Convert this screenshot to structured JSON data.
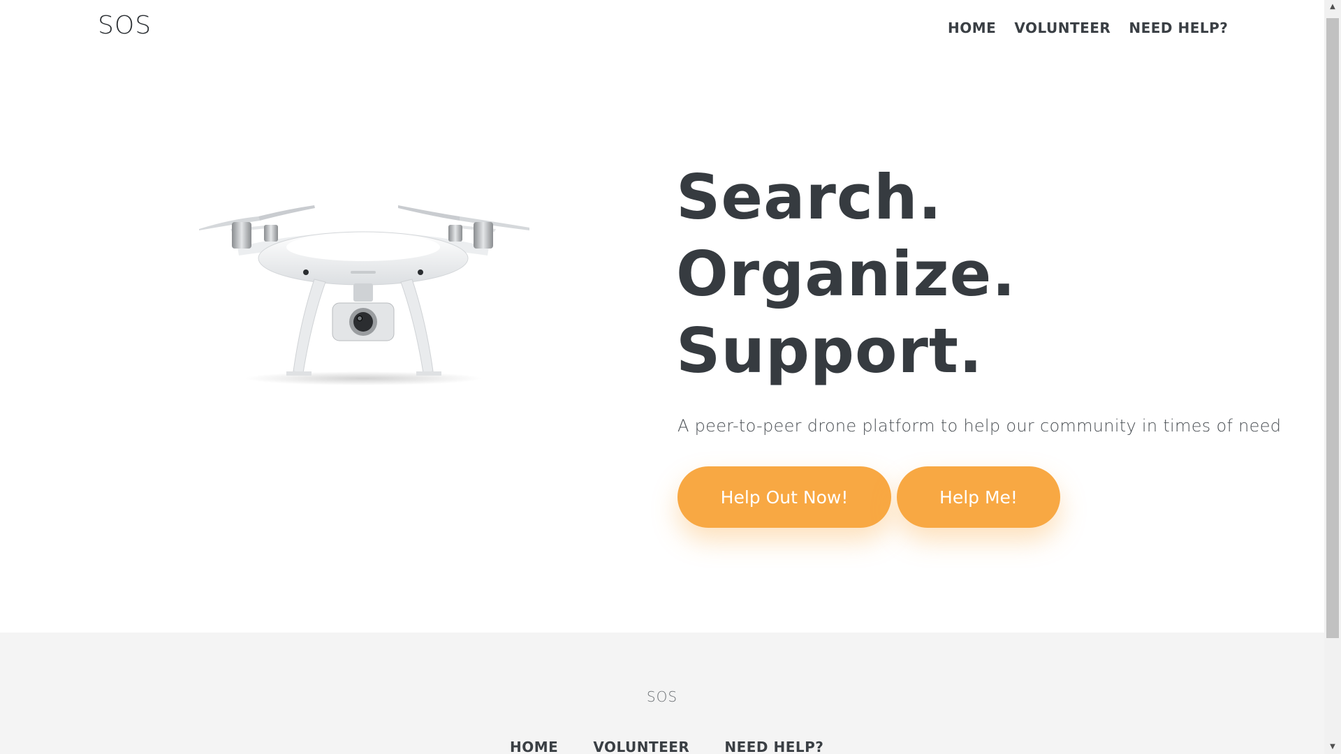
{
  "header": {
    "brand": "SOS",
    "nav": [
      {
        "label": "HOME"
      },
      {
        "label": "VOLUNTEER"
      },
      {
        "label": "NEED HELP?"
      }
    ]
  },
  "hero": {
    "image_icon": "drone-image",
    "headline": [
      "Search.",
      "Organize.",
      "Support."
    ],
    "tagline": "A peer-to-peer drone platform to help our community in times of need",
    "buttons": {
      "help_out": "Help Out Now!",
      "help_me": "Help Me!"
    },
    "button_color": "#f8a843"
  },
  "footer": {
    "brand": "SOS",
    "nav": [
      {
        "label": "HOME"
      },
      {
        "label": "VOLUNTEER"
      },
      {
        "label": "NEED HELP?"
      }
    ],
    "background": "#f4f4f4"
  },
  "scrollbar": {
    "up_icon": "scroll-up-arrow-icon",
    "down_icon": "scroll-down-arrow-icon"
  }
}
